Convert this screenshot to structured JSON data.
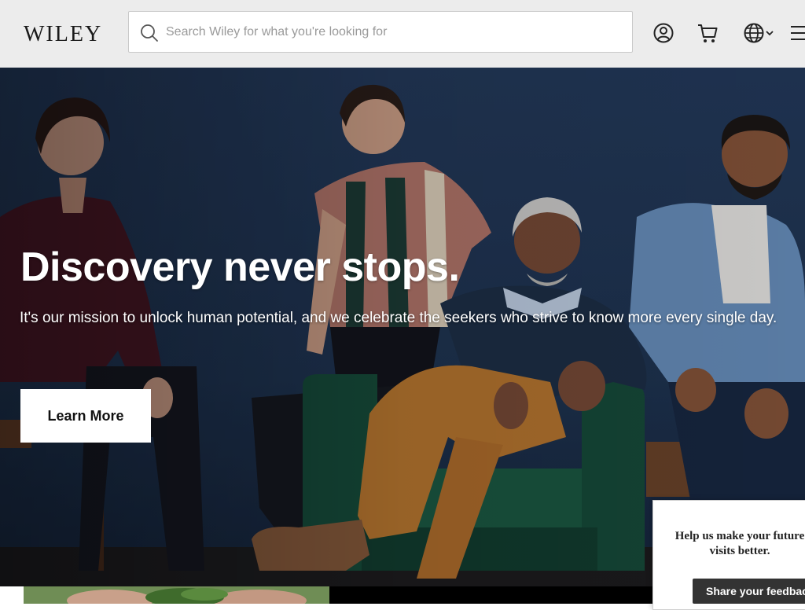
{
  "header": {
    "logo": "WILEY",
    "search": {
      "placeholder": "Search Wiley for what you're looking for",
      "value": ""
    },
    "icons": [
      "account-icon",
      "cart-icon",
      "globe-icon",
      "chevron-down-icon",
      "menu-icon"
    ]
  },
  "hero": {
    "title": "Discovery never stops.",
    "subtitle": "It's our mission to unlock human potential, and we celebrate the seekers who strive to know more every single day.",
    "cta_label": "Learn More"
  },
  "feedback": {
    "text": "Help us make your future visits better.",
    "button_label": "Share your feedback"
  },
  "colors": {
    "header_bg": "#ececec",
    "hero_wall": "#1f3452",
    "feedback_button": "#333333"
  }
}
